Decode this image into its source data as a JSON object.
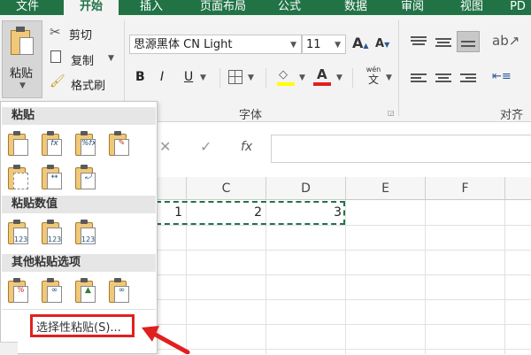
{
  "tabs": [
    "文件",
    "开始",
    "插入",
    "页面布局",
    "公式",
    "数据",
    "审阅",
    "视图",
    "PD"
  ],
  "active_tab": "开始",
  "clipboard": {
    "paste_label": "粘贴",
    "cut_label": "剪切",
    "copy_label": "复制",
    "format_painter_label": "格式刷"
  },
  "font": {
    "name": "思源黑体 CN Light",
    "size": "11",
    "group_label": "字体",
    "bold": "B",
    "italic": "I",
    "underline": "U",
    "grow": "A",
    "shrink": "A",
    "font_color_glyph": "A",
    "phonetic_top": "wén",
    "phonetic_bottom": "文"
  },
  "alignment": {
    "group_label": "对齐方"
  },
  "formula_bar": {
    "cancel": "✕",
    "enter": "✓",
    "fx": "fx"
  },
  "grid": {
    "columns": [
      "C",
      "D",
      "E",
      "F"
    ],
    "values": [
      {
        "col": "B",
        "value": "1"
      },
      {
        "col": "C",
        "value": "2"
      },
      {
        "col": "D",
        "value": "3"
      }
    ]
  },
  "paste_menu": {
    "section_paste": "粘贴",
    "section_values": "粘贴数值",
    "section_other": "其他粘贴选项",
    "paste_special": "选择性粘贴(S)...",
    "value_icon_text": "123"
  },
  "colors": {
    "ribbon_green": "#217346",
    "highlight_red": "#e02020",
    "marching_ants": "#217346"
  }
}
